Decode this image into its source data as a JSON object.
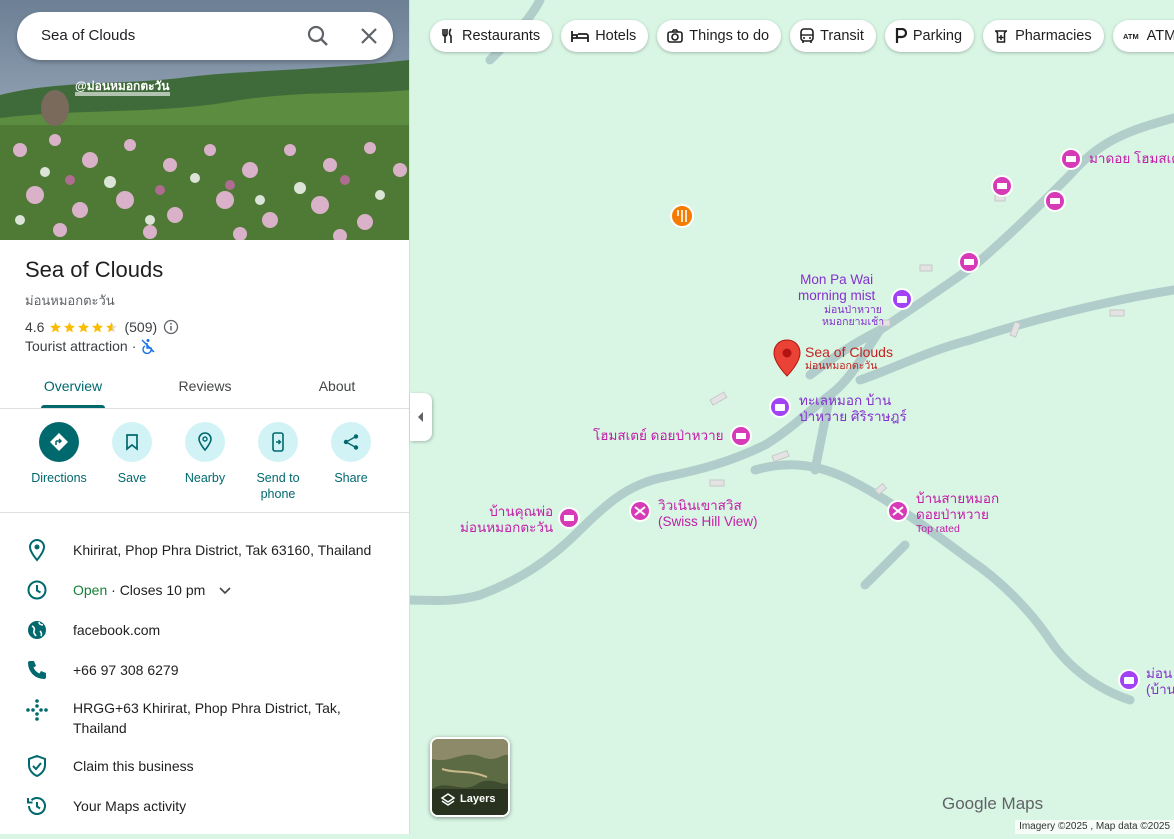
{
  "search": {
    "value": "Sea of Clouds"
  },
  "hero": {
    "watermark": "@ม่อนหมอกตะวัน"
  },
  "place": {
    "title": "Sea of Clouds",
    "subtitle": "ม่อนหมอกตะวัน",
    "rating": "4.6",
    "stars": 4.6,
    "review_count": "(509)",
    "category": "Tourist attraction",
    "separator": "·"
  },
  "tabs": [
    {
      "label": "Overview",
      "active": true
    },
    {
      "label": "Reviews",
      "active": false
    },
    {
      "label": "About",
      "active": false
    }
  ],
  "actions": [
    {
      "label": "Directions",
      "icon": "directions-icon"
    },
    {
      "label": "Save",
      "icon": "bookmark-icon"
    },
    {
      "label": "Nearby",
      "icon": "nearby-icon"
    },
    {
      "label": "Send to phone",
      "icon": "send-to-phone-icon"
    },
    {
      "label": "Share",
      "icon": "share-icon"
    }
  ],
  "info": {
    "address": "Khirirat, Phop Phra District, Tak 63160, Thailand",
    "hours_status": "Open",
    "hours_detail": " · Closes 10 pm",
    "website": "facebook.com",
    "phone": "+66 97 308 6279",
    "plus_code": "HRGG+63 Khirirat, Phop Phra District, Tak, Thailand",
    "claim": "Claim this business",
    "activity": "Your Maps activity"
  },
  "filters": [
    {
      "label": "Restaurants",
      "icon": "fork-knife-icon"
    },
    {
      "label": "Hotels",
      "icon": "bed-icon"
    },
    {
      "label": "Things to do",
      "icon": "camera-icon"
    },
    {
      "label": "Transit",
      "icon": "bus-icon"
    },
    {
      "label": "Parking",
      "icon": "parking-icon"
    },
    {
      "label": "Pharmacies",
      "icon": "pharmacy-icon"
    },
    {
      "label": "ATMs",
      "icon": "atm-icon"
    }
  ],
  "map": {
    "selected_name": "Sea of Clouds",
    "selected_local": "ม่อนหมอกตะวัน",
    "pois": {
      "mon_pa_wai": "Mon Pa Wai\nmorning mist",
      "mon_pa_wai_th": "ม่อนป่าหวาย\nหมอกยามเช้า",
      "sea_mist_thai": "ทะเลหมอก บ้าน\nป่าหวาย ศิริราษฎร์",
      "homestay_doi": "โฮมสเตย์ ดอยป่าหวาย",
      "ban_khun_pho": "บ้านคุณพ่อ\nม่อนหมอกตะวัน",
      "swiss_hill": "วิวเนินเขาสวิส\n(Swiss Hill View)",
      "ban_sai_mok": "บ้านสายหมอก\nดอยป่าหวาย",
      "top_rated": "Top rated",
      "ma_doi": "มาดอย โฮมสเต",
      "edge_poi": "ม่อน\n(บ้าน"
    },
    "layers_label": "Layers",
    "brand": "Google Maps",
    "attribution": "Imagery ©2025 , Map data ©2025"
  },
  "colors": {
    "accent": "#00696e",
    "hotel": "#c21ca8",
    "attraction": "#8430ce",
    "open": "#188038",
    "map_bg": "#d9f6e4"
  }
}
